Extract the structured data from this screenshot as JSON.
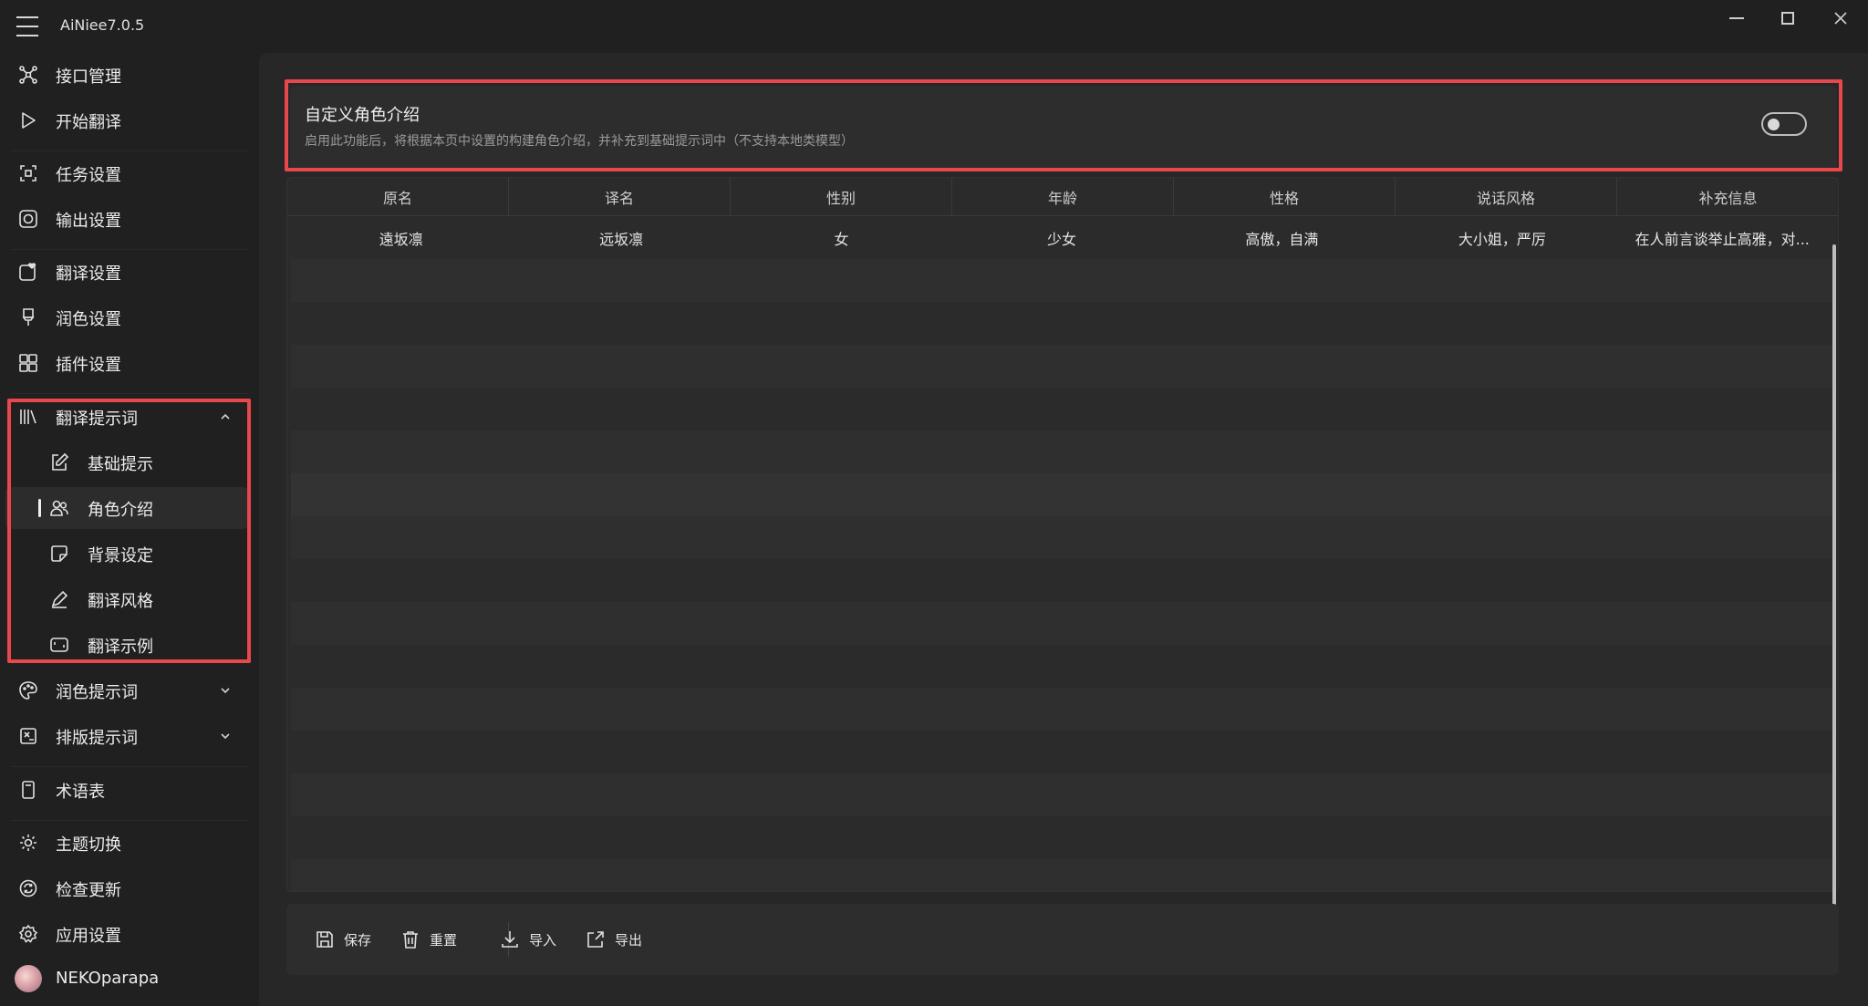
{
  "app": {
    "title": "AiNiee7.0.5"
  },
  "sidebar": {
    "items": [
      {
        "label": "接口管理",
        "icon": "network-icon"
      },
      {
        "label": "开始翻译",
        "icon": "play-icon"
      },
      {
        "label": "任务设置",
        "icon": "task-icon"
      },
      {
        "label": "输出设置",
        "icon": "output-icon"
      },
      {
        "label": "翻译设置",
        "icon": "heart-icon"
      },
      {
        "label": "润色设置",
        "icon": "brush-icon"
      },
      {
        "label": "插件设置",
        "icon": "plugin-icon"
      },
      {
        "label": "翻译提示词",
        "icon": "library-icon",
        "expanded": true
      },
      {
        "label": "基础提示",
        "icon": "edit-icon"
      },
      {
        "label": "角色介绍",
        "icon": "people-icon",
        "selected": true
      },
      {
        "label": "背景设定",
        "icon": "note-icon"
      },
      {
        "label": "翻译风格",
        "icon": "pen-icon"
      },
      {
        "label": "翻译示例",
        "icon": "frame-icon"
      },
      {
        "label": "润色提示词",
        "icon": "palette-icon"
      },
      {
        "label": "排版提示词",
        "icon": "layout-icon"
      },
      {
        "label": "术语表",
        "icon": "book-icon"
      },
      {
        "label": "主题切换",
        "icon": "sun-icon"
      },
      {
        "label": "检查更新",
        "icon": "refresh-icon"
      },
      {
        "label": "应用设置",
        "icon": "gear-icon"
      }
    ],
    "user": "NEKOparapa"
  },
  "main": {
    "toggle_card": {
      "title": "自定义角色介绍",
      "description": "启用此功能后，将根据本页中设置的构建角色介绍，并补充到基础提示词中（不支持本地类模型）",
      "enabled": false
    },
    "table": {
      "headers": [
        "原名",
        "译名",
        "性别",
        "年龄",
        "性格",
        "说话风格",
        "补充信息"
      ],
      "rows": [
        [
          "遠坂凛",
          "远坂凛",
          "女",
          "少女",
          "高傲，自满",
          "大小姐，严厉",
          "在人前言谈举止高雅，对..."
        ]
      ]
    },
    "toolbar": {
      "save": "保存",
      "reset": "重置",
      "import": "导入",
      "export": "导出"
    }
  },
  "colors": {
    "highlight": "#e8474b",
    "background": "#202020",
    "panel": "#272727"
  }
}
